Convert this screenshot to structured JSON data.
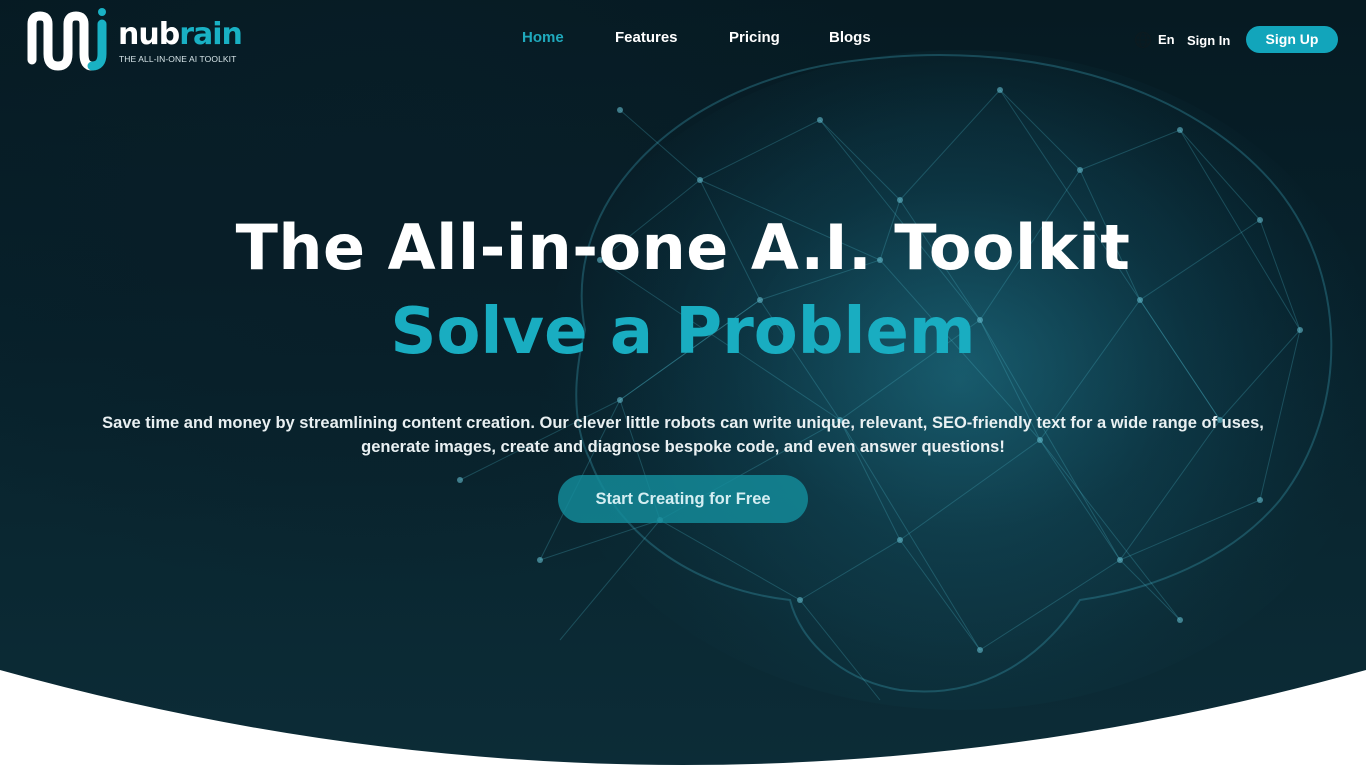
{
  "brand": {
    "name_part1": "nub",
    "name_part2": "rain",
    "tagline": "THE ALL-IN-ONE AI TOOLKIT",
    "icon": "nubrain-wave-logo",
    "accent_color": "#19b1c4"
  },
  "nav": {
    "items": [
      {
        "label": "Home",
        "active": true
      },
      {
        "label": "Features",
        "active": false
      },
      {
        "label": "Pricing",
        "active": false
      },
      {
        "label": "Blogs",
        "active": false
      }
    ]
  },
  "header_actions": {
    "language_icon": "globe-icon",
    "language_label": "En",
    "signin_label": "Sign In",
    "signup_label": "Sign Up"
  },
  "hero": {
    "headline": "The All-in-one A.I. Toolkit",
    "subheadline": "Solve a Problem",
    "description": "Save time and money by streamlining content creation. Our clever little robots can write unique, relevant, SEO-friendly text for a wide range of uses, generate images, create and diagnose bespoke code, and even answer questions!",
    "cta_label": "Start Creating for Free",
    "background": "brain-network-image",
    "background_color": "#07202a",
    "cta_color": "#148c9b"
  }
}
